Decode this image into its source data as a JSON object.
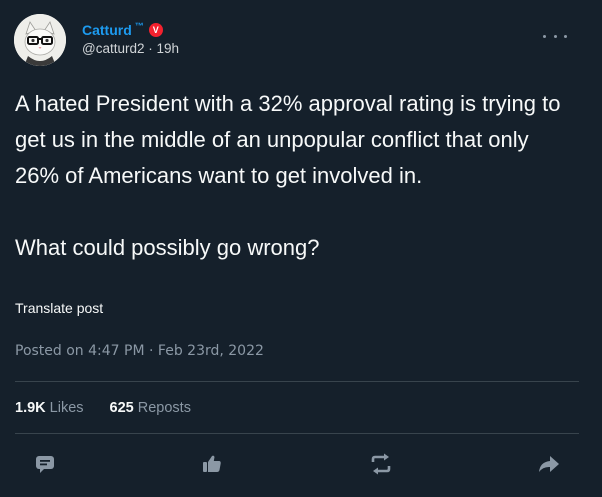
{
  "author": {
    "display_name": "Catturd",
    "tm_mark": "™",
    "badge_letter": "V",
    "handle": "@catturd2",
    "separator": "·",
    "time_ago": "19h"
  },
  "post": {
    "paragraph_1": "A hated President with a 32% approval rating is trying to get us in the middle of an unpopular conflict that only 26% of Americans want to get involved in.",
    "paragraph_2": "What could possibly go wrong?",
    "translate_label": "Translate post",
    "posted_prefix": "Posted on",
    "posted_time": "4:47 PM",
    "posted_separator": "·",
    "posted_date": "Feb 23rd, 2022"
  },
  "stats": {
    "likes_count": "1.9K",
    "likes_label": "Likes",
    "reposts_count": "625",
    "reposts_label": "Reposts"
  },
  "actions": [
    "reply-icon",
    "like-icon",
    "repost-icon",
    "share-icon"
  ],
  "colors": {
    "background": "#15202b",
    "accent": "#1d9bf0",
    "badge": "#f4212e",
    "secondary_text": "#8b98a5",
    "divider": "#38444d"
  }
}
